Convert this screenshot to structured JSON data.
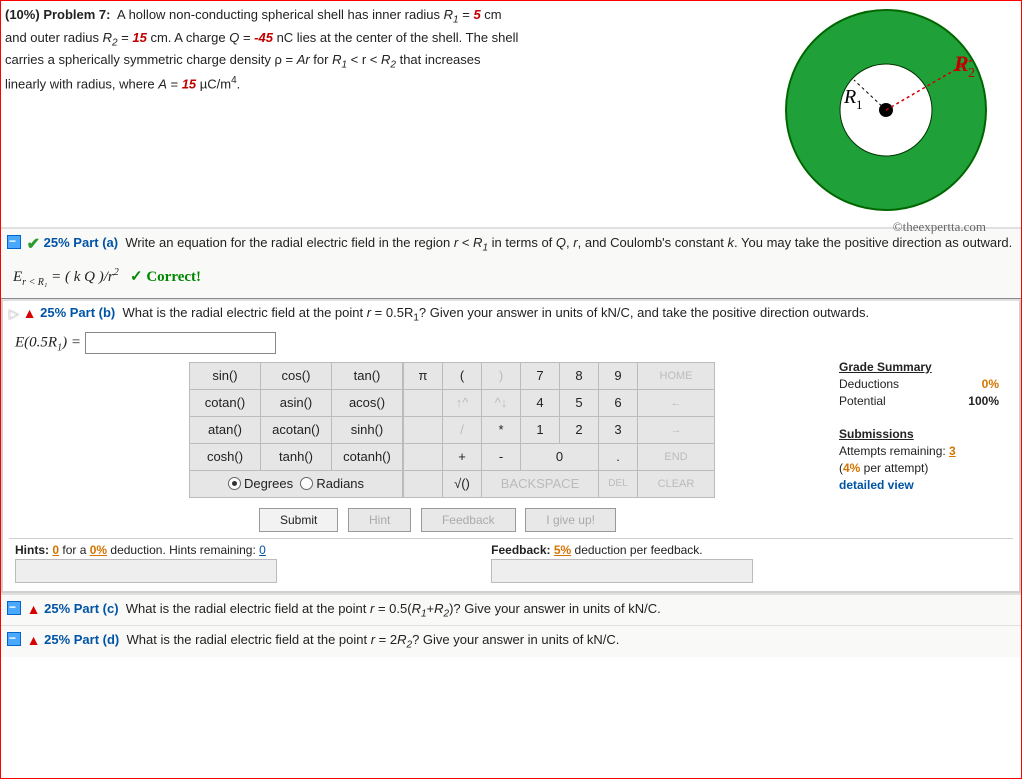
{
  "problem": {
    "percent_label": "(10%)",
    "number_label": "Problem 7:",
    "text_1": "A hollow non-conducting spherical shell has inner radius ",
    "R1_label": "R",
    "R1_sub": "1",
    "R1_eq": " = ",
    "R1_val": "5",
    "R1_unit": " cm",
    "text_2": "and outer radius ",
    "R2_label": "R",
    "R2_sub": "2",
    "R2_eq": " = ",
    "R2_val": "15",
    "R2_unit": " cm. A charge ",
    "Q_label": "Q",
    "Q_eq": " = ",
    "Q_val": "-45",
    "Q_unit": " nC lies at the center of the shell. The shell",
    "text_3": "carries a spherically symmetric charge density ρ = ",
    "Ar": "Ar",
    "text_3b": " for ",
    "text_3c": " < r < ",
    "text_3d": " that increases",
    "text_4": "linearly with radius, where ",
    "A_label": "A",
    "A_eq": " = ",
    "A_val": "15",
    "A_unit": " µC/m",
    "A_exp": "4",
    "period": "."
  },
  "copyright": "©theexpertta.com",
  "partA": {
    "pct": "25% Part (a)",
    "question": "Write an equation for the radial electric field in the region ",
    "question2": " in terms of ",
    "question3": ", and Coulomb's constant ",
    "question4": ". You may take the positive direction as outward.",
    "eq_left": "E",
    "eq_sub": "r < R₁",
    "eq_right": " = ( k Q )/r",
    "eq_exp": "2",
    "correct": "✓ Correct!"
  },
  "partB": {
    "pct": "25% Part (b)",
    "question": "What is the radial electric field at the point ",
    "question_mid": " = 0.5R",
    "question_end": "? Given your answer in units of kN/C, and take the positive direction outwards.",
    "eq_label": "E(0.5R",
    "eq_sub": "1",
    "eq_close": ") ="
  },
  "keypad": {
    "fns": [
      [
        "sin()",
        "cos()",
        "tan()"
      ],
      [
        "cotan()",
        "asin()",
        "acos()"
      ],
      [
        "atan()",
        "acotan()",
        "sinh()"
      ],
      [
        "cosh()",
        "tanh()",
        "cotanh()"
      ]
    ],
    "row1": [
      "π",
      "(",
      ")",
      "7",
      "8",
      "9",
      "HOME"
    ],
    "row2": [
      "",
      "↑^",
      "^↓",
      "4",
      "5",
      "6",
      "←"
    ],
    "row3": [
      "",
      "/",
      "*",
      "1",
      "2",
      "3",
      "→"
    ],
    "row4": [
      "",
      "+",
      "-",
      "0",
      "0",
      ".",
      "END"
    ],
    "row5": [
      "",
      "√()",
      "BACKSPACE",
      "BACKSPACE",
      "BACKSPACE",
      "DEL",
      "CLEAR"
    ],
    "degrees": "Degrees",
    "radians": "Radians"
  },
  "actions": {
    "submit": "Submit",
    "hint": "Hint",
    "feedback": "Feedback",
    "giveup": "I give up!"
  },
  "hints": {
    "left_lead": "Hints: ",
    "left_n": "0",
    "left_mid": " for a ",
    "left_pct": "0%",
    "left_tail": " deduction. Hints remaining: ",
    "left_rem": "0",
    "right_lead": "Feedback: ",
    "right_pct": "5%",
    "right_tail": " deduction per feedback."
  },
  "grade": {
    "title": "Grade Summary",
    "deductions_l": "Deductions",
    "deductions_v": "0%",
    "potential_l": "Potential",
    "potential_v": "100%",
    "sub_title": "Submissions",
    "attempts_l": "Attempts remaining: ",
    "attempts_v": "3",
    "per_l": "(",
    "per_v": "4%",
    "per_tail": " per attempt)",
    "detailed": "detailed view"
  },
  "partC": {
    "pct": "25% Part (c)",
    "q": "What is the radial electric field at the point ",
    "q2": " = 0.5(",
    "q3": "+",
    "q4": ")? Give your answer in units of kN/C."
  },
  "partD": {
    "pct": "25% Part (d)",
    "q": "What is the radial electric field at the point ",
    "q2": " = 2",
    "q3": "? Give your answer in units of kN/C."
  },
  "chart_data": {
    "type": "diagram",
    "description": "Concentric spherical shell cross-section",
    "R1_cm": 5,
    "R2_cm": 15,
    "Q_nC": -45,
    "A_uC_per_m4": 15,
    "labels": {
      "inner": "R₁",
      "outer": "R₂"
    }
  }
}
